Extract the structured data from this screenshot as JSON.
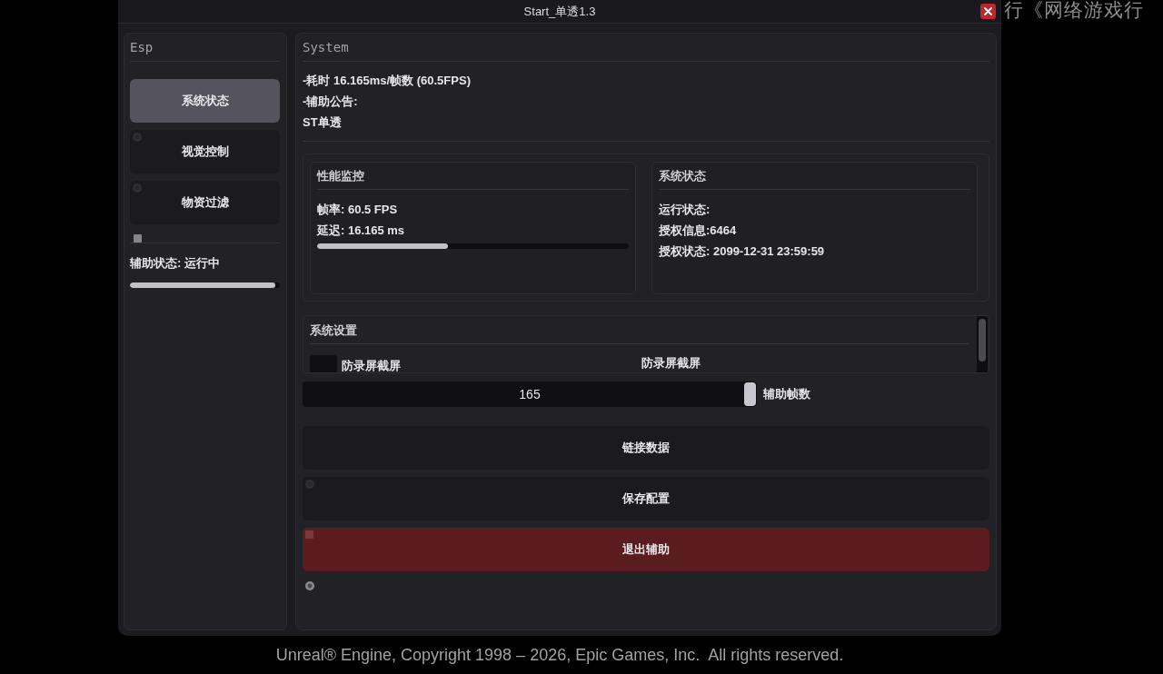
{
  "window": {
    "title": "Start_单透1.3"
  },
  "background_text": "行《网络游戏行",
  "sidebar": {
    "title": "Esp",
    "items": [
      {
        "label": "系统状态",
        "selected": true,
        "kind": "plain"
      },
      {
        "label": "视觉控制",
        "selected": false,
        "kind": "ringed"
      },
      {
        "label": "物资过滤",
        "selected": false,
        "kind": "ringed"
      }
    ],
    "status": {
      "label": "辅助状态: 运行中",
      "level": 0.97
    }
  },
  "main": {
    "title": "System",
    "info_lines": [
      "-耗时 16.165ms/帧数 (60.5FPS)",
      "-辅助公告:",
      "ST单透"
    ],
    "cards": [
      {
        "title": "性能监控",
        "lines": [
          "帧率: 60.5 FPS",
          "延迟: 16.165 ms"
        ],
        "meter": {
          "level": 0.42
        }
      },
      {
        "title": "系统状态",
        "lines": [
          "运行状态:",
          "授权信息:6464",
          "授权状态: 2099-12-31 23:59:59"
        ]
      }
    ],
    "settings": {
      "title": "系统设置",
      "options": [
        {
          "label": "防录屏截屏",
          "checked": false,
          "caption": "防录屏截屏"
        }
      ]
    },
    "slider": {
      "value": "165",
      "label": "辅助帧数",
      "level": 1
    },
    "buttons": [
      {
        "label": "链接数据",
        "kind": "plain"
      },
      {
        "label": "保存配置",
        "kind": "ringed"
      },
      {
        "label": "退出辅助",
        "kind": "danger"
      }
    ]
  },
  "footer": "Unreal® Engine, Copyright 1998 – 2026, Epic Games, Inc.  All rights reserved."
}
